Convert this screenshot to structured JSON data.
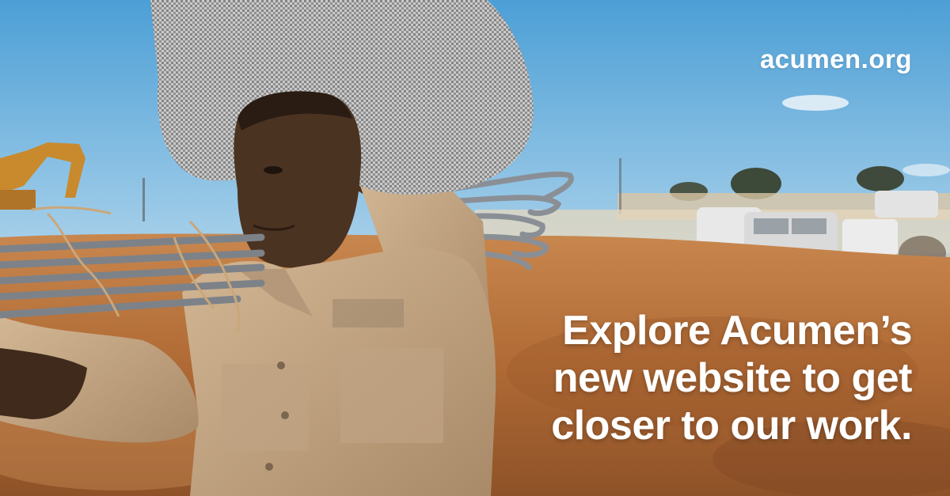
{
  "brand": {
    "domain": "acumen.org"
  },
  "headline": {
    "lines": [
      "Explore Acumen’s",
      "new website to get",
      "closer to our work."
    ]
  },
  "colors": {
    "sky": "#5aa9dd",
    "soil": "#b8703a",
    "shirt": "#c9a882",
    "text": "#ffffff"
  }
}
